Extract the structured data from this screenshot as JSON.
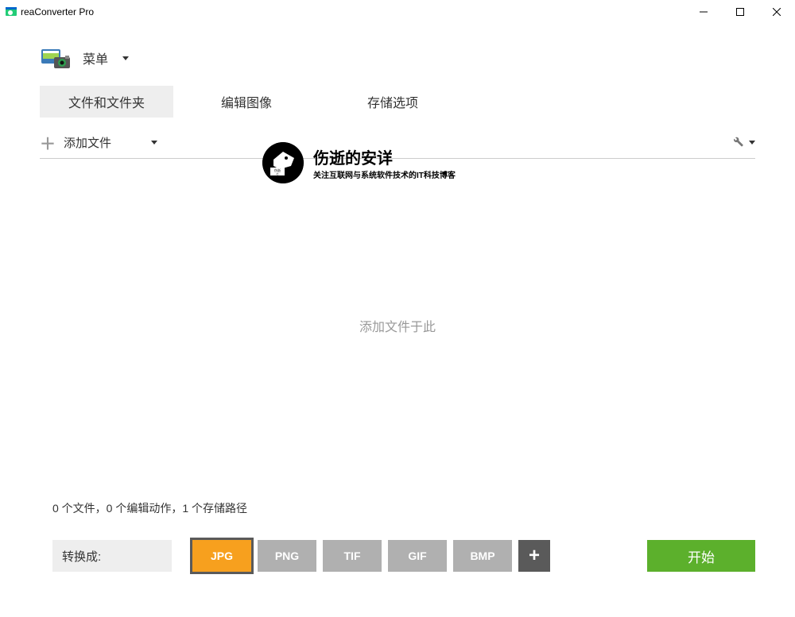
{
  "window": {
    "title": "reaConverter Pro"
  },
  "menu": {
    "label": "菜单"
  },
  "tabs": {
    "files": "文件和文件夹",
    "edit": "编辑图像",
    "save": "存储选项"
  },
  "toolbar": {
    "add_files": "添加文件"
  },
  "watermark": {
    "title": "伤逝的安详",
    "subtitle": "关注互联网与系统软件技术的IT科技博客"
  },
  "drop": {
    "hint": "添加文件于此"
  },
  "status": {
    "text": "0 个文件，0 个编辑动作，1 个存储路径"
  },
  "bottom": {
    "convert_label": "转换成:",
    "formats": [
      "JPG",
      "PNG",
      "TIF",
      "GIF",
      "BMP"
    ],
    "selected_format": "JPG",
    "start": "开始"
  }
}
